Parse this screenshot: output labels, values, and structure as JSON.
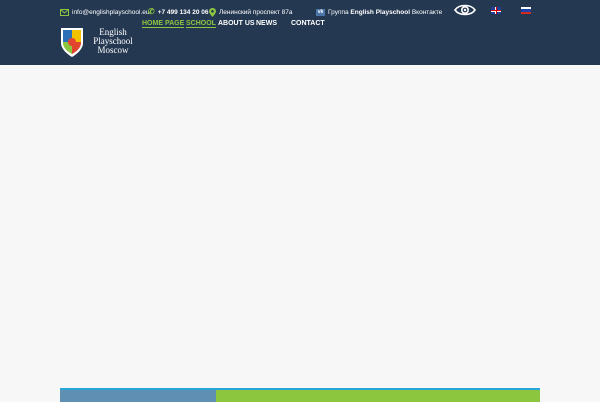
{
  "topbar": {
    "email": "info@englishplayschool.eu",
    "phone": "+7 499 134 20 06",
    "address": "Ленинский проспект 87а",
    "vk_prefix": "Группа",
    "vk_group": "English Playschool",
    "vk_suffix": "Вконтакте"
  },
  "logo": {
    "line1": "English",
    "line2": "Playschool",
    "line3": "Moscow"
  },
  "nav": {
    "items": [
      {
        "label": "HOME PAGE"
      },
      {
        "label": "SCHOOL"
      },
      {
        "label": "ABOUT US"
      },
      {
        "label": "NEWS"
      },
      {
        "label": "CONTACT"
      }
    ]
  },
  "colors": {
    "header_bg": "#253852",
    "accent_green": "#8cc63f",
    "page_bg": "#f7f7f7"
  },
  "icons": [
    "envelope-icon",
    "phone-icon",
    "map-pin-icon",
    "vk-icon",
    "eye-icon"
  ]
}
